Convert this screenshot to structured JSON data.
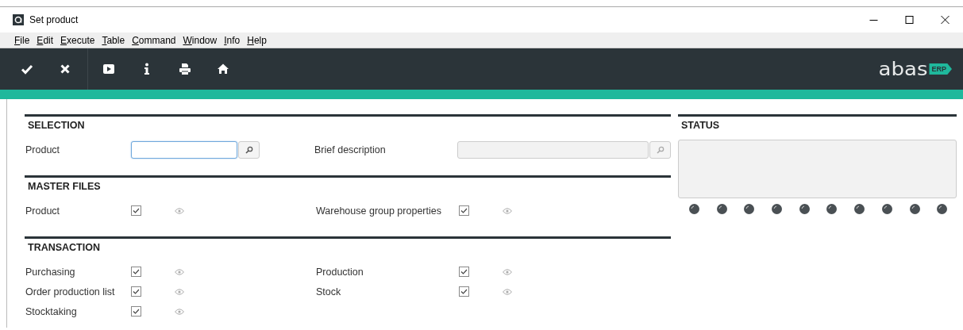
{
  "window": {
    "title": "Set product"
  },
  "menu": [
    "File",
    "Edit",
    "Execute",
    "Table",
    "Command",
    "Window",
    "Info",
    "Help"
  ],
  "toolbar": {
    "buttons": [
      {
        "kind": "confirm"
      },
      {
        "kind": "cancel"
      },
      {
        "kind": "play"
      },
      {
        "kind": "info"
      },
      {
        "kind": "print"
      },
      {
        "kind": "home"
      }
    ]
  },
  "logo": {
    "text": "abas",
    "badge": "ERP"
  },
  "sections": [
    {
      "title": "SELECTION",
      "rows": [
        [
          {
            "kind": "lookup",
            "label": "Product",
            "focused": true,
            "disabled": false
          },
          {
            "kind": "lookup",
            "label": "Brief description",
            "focused": false,
            "disabled": true
          }
        ]
      ]
    },
    {
      "title": "MASTER FILES",
      "rows": [
        [
          {
            "kind": "check",
            "label": "Product",
            "checked": true
          },
          {
            "kind": "check",
            "label": "Warehouse group properties",
            "checked": true
          }
        ]
      ]
    },
    {
      "title": "TRANSACTION",
      "rows": [
        [
          {
            "kind": "check",
            "label": "Purchasing",
            "checked": true
          },
          {
            "kind": "check",
            "label": "Production",
            "checked": true
          }
        ],
        [
          {
            "kind": "check",
            "label": "Order production list",
            "checked": true
          },
          {
            "kind": "check",
            "label": "Stock",
            "checked": true
          }
        ],
        [
          {
            "kind": "check",
            "label": "Stocktaking",
            "checked": true
          }
        ]
      ]
    }
  ],
  "status": {
    "title": "STATUS"
  }
}
